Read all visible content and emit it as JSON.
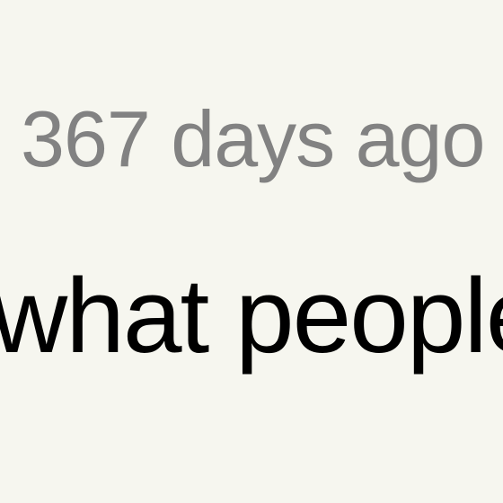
{
  "comment": {
    "age": "367 days ago",
    "text_fragment": "what people"
  }
}
